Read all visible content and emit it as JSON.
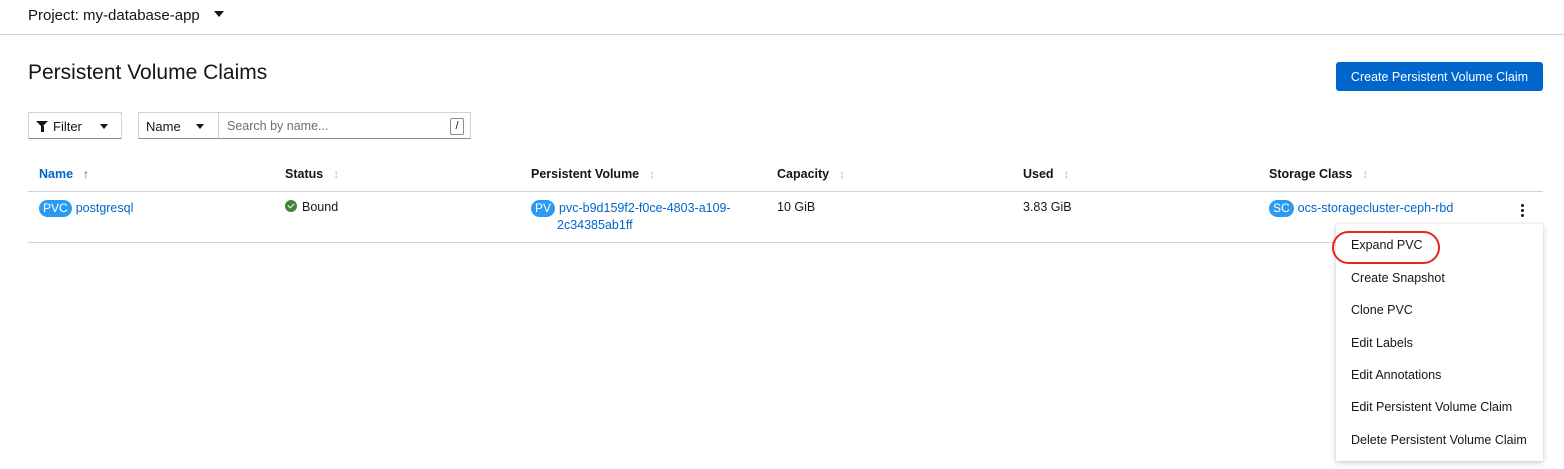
{
  "header": {
    "project_label": "Project: my-database-app"
  },
  "page": {
    "title": "Persistent Volume Claims",
    "create_button": "Create Persistent Volume Claim"
  },
  "toolbar": {
    "filter_label": "Filter",
    "name_select": "Name",
    "search_placeholder": "Search by name...",
    "shortcut_key": "/"
  },
  "table": {
    "columns": [
      "Name",
      "Status",
      "Persistent Volume",
      "Capacity",
      "Used",
      "Storage Class"
    ],
    "sorted_column": "Name",
    "rows": [
      {
        "name_badge": "PVC",
        "name": "postgresql",
        "status": "Bound",
        "pv_badge": "PV",
        "pv_line1": "pvc-b9d159f2-f0ce-4803-a109-",
        "pv_line2": "2c34385ab1ff",
        "capacity": "10 GiB",
        "used": "3.83 GiB",
        "sc_badge": "SC",
        "storage_class": "ocs-storagecluster-ceph-rbd"
      }
    ]
  },
  "menu": {
    "items": [
      "Expand PVC",
      "Create Snapshot",
      "Clone PVC",
      "Edit Labels",
      "Edit Annotations",
      "Edit Persistent Volume Claim",
      "Delete Persistent Volume Claim"
    ],
    "highlighted": "Expand PVC"
  },
  "colors": {
    "primary": "#0066cc",
    "badge": "#2b9af3",
    "status_ok": "#3e8635",
    "highlight": "#e8241c"
  }
}
